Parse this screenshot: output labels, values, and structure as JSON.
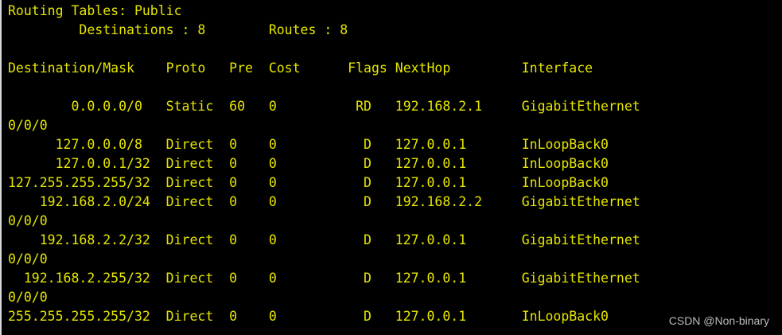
{
  "terminal": {
    "text_color": "#e6e600",
    "background_color": "#000000",
    "lines": [
      "Routing Tables: Public",
      "         Destinations : 8        Routes : 8",
      "",
      "Destination/Mask    Proto   Pre  Cost      Flags NextHop         Interface",
      "",
      "        0.0.0.0/0   Static  60   0          RD   192.168.2.1     GigabitEthernet",
      "0/0/0",
      "      127.0.0.0/8   Direct  0    0           D   127.0.0.1       InLoopBack0",
      "      127.0.0.1/32  Direct  0    0           D   127.0.0.1       InLoopBack0",
      "127.255.255.255/32  Direct  0    0           D   127.0.0.1       InLoopBack0",
      "    192.168.2.0/24  Direct  0    0           D   192.168.2.2     GigabitEthernet",
      "0/0/0",
      "    192.168.2.2/32  Direct  0    0           D   127.0.0.1       GigabitEthernet",
      "0/0/0",
      "  192.168.2.255/32  Direct  0    0           D   127.0.0.1       GigabitEthernet",
      "0/0/0",
      "255.255.255.255/32  Direct  0    0           D   127.0.0.1       InLoopBack0"
    ]
  },
  "watermark": {
    "text": "CSDN @Non-binary"
  }
}
